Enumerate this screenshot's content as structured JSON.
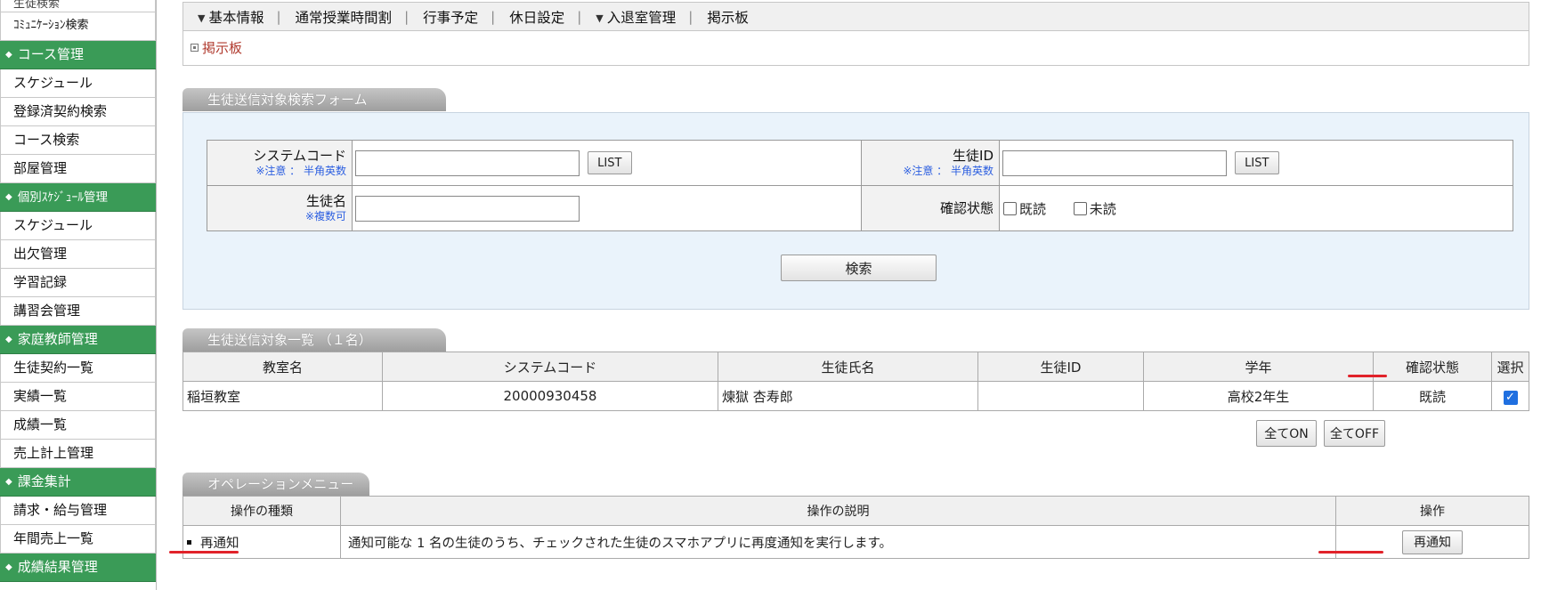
{
  "sidebar": {
    "items": [
      {
        "type": "item",
        "label": "生徒検索",
        "cls": "first"
      },
      {
        "type": "item",
        "label": "ｺﾐｭﾆｹｰｼｮﾝ検索",
        "cls": "small"
      },
      {
        "type": "header",
        "label": "コース管理"
      },
      {
        "type": "item",
        "label": "スケジュール"
      },
      {
        "type": "item",
        "label": "登録済契約検索"
      },
      {
        "type": "item",
        "label": "コース検索"
      },
      {
        "type": "item",
        "label": "部屋管理"
      },
      {
        "type": "header",
        "label": "個別ｽｹｼﾞｭｰﾙ管理",
        "cls": "small"
      },
      {
        "type": "item",
        "label": "スケジュール"
      },
      {
        "type": "item",
        "label": "出欠管理"
      },
      {
        "type": "item",
        "label": "学習記録"
      },
      {
        "type": "item",
        "label": "講習会管理"
      },
      {
        "type": "header",
        "label": "家庭教師管理"
      },
      {
        "type": "item",
        "label": "生徒契約一覧"
      },
      {
        "type": "item",
        "label": "実績一覧"
      },
      {
        "type": "item",
        "label": "成績一覧"
      },
      {
        "type": "item",
        "label": "売上計上管理"
      },
      {
        "type": "header",
        "label": "課金集計"
      },
      {
        "type": "item",
        "label": "請求・給与管理"
      },
      {
        "type": "item",
        "label": "年間売上一覧"
      },
      {
        "type": "header",
        "label": "成績結果管理"
      }
    ]
  },
  "topnav": {
    "basic_info": "基本情報",
    "regular_timetable": "通常授業時間割",
    "events": "行事予定",
    "holidays": "休日設定",
    "entry_exit": "入退室管理",
    "bulletin": "掲示板",
    "separator": "|"
  },
  "bulletin_link": "掲示板",
  "search_form": {
    "tab_title": "生徒送信対象検索フォーム",
    "system_code_label": "システムコード",
    "system_code_note": "※注意 ： 半角英数",
    "system_code_value": "",
    "list_label": "LIST",
    "student_id_label": "生徒ID",
    "student_id_note": "※注意 ： 半角英数",
    "student_id_value": "",
    "student_name_label": "生徒名",
    "student_name_note": "※複数可",
    "student_name_value": "",
    "status_label": "確認状態",
    "status_read": "既読",
    "status_unread": "未読",
    "search_button": "検索"
  },
  "results": {
    "tab_title": "生徒送信対象一覧 （１名）",
    "columns": [
      "教室名",
      "システムコード",
      "生徒氏名",
      "生徒ID",
      "学年",
      "確認状態",
      "選択"
    ],
    "rows": [
      {
        "classroom": "稲垣教室",
        "system_code": "20000930458",
        "name": "煉獄 杏寿郎",
        "student_id": "",
        "grade": "高校2年生",
        "status": "既読",
        "selected": true
      }
    ],
    "all_on": "全てON",
    "all_off": "全てOFF"
  },
  "operations": {
    "tab_title": "オペレーションメニュー",
    "columns": [
      "操作の種類",
      "操作の説明",
      "操作"
    ],
    "rows": [
      {
        "type": "再通知",
        "description": "通知可能な 1 名の生徒のうち、チェックされた生徒のスマホアプリに再度通知を実行します。",
        "button": "再通知"
      }
    ]
  },
  "colors": {
    "sidebar_header": "#3a9b57",
    "accent_red": "#e1222a",
    "checkbox_blue": "#1f6fe0",
    "note_blue": "#2b5ee0"
  }
}
